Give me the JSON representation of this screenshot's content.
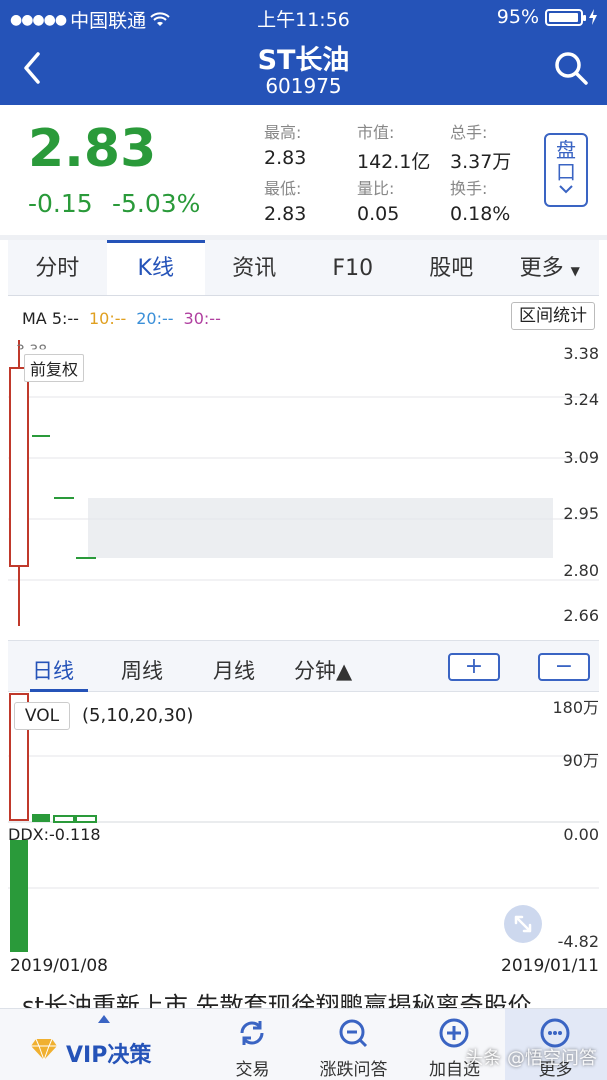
{
  "status_bar": {
    "carrier": "中国联通",
    "time": "上午11:56",
    "battery": "95%"
  },
  "header": {
    "title": "ST长油",
    "code": "601975"
  },
  "quote": {
    "price": "2.83",
    "change": "-0.15",
    "change_pct": "-5.03%",
    "stats": [
      {
        "label": "最高:",
        "value": "2.83"
      },
      {
        "label": "市值:",
        "value": "142.1亿"
      },
      {
        "label": "总手:",
        "value": "3.37万"
      },
      {
        "label": "最低:",
        "value": "2.83"
      },
      {
        "label": "量比:",
        "value": "0.05"
      },
      {
        "label": "换手:",
        "value": "0.18%"
      }
    ],
    "pan_button": "盘口"
  },
  "tabs": [
    "分时",
    "K线",
    "资讯",
    "F10",
    "股吧",
    "更多"
  ],
  "active_tab": "K线",
  "chart": {
    "ma": {
      "ma5": "MA 5:--",
      "ma10": "10:--",
      "ma20": "20:--",
      "ma30": "30:--"
    },
    "ma_colors": {
      "ma5": "#222222",
      "ma10": "#e0a020",
      "ma20": "#3a8fd8",
      "ma30": "#b040a0"
    },
    "range_button": "区间统计",
    "adjust_label": "前复权",
    "top_price_label": "3.38",
    "y_ticks": [
      "3.38",
      "3.24",
      "3.09",
      "2.95",
      "2.80",
      "2.66"
    ],
    "up_color": "#c0392b",
    "down_color": "#2a9a3a"
  },
  "periods": {
    "day": "日线",
    "week": "周线",
    "month": "月线",
    "minute": "分钟▲",
    "zoom_in": "+",
    "zoom_out": "−"
  },
  "volume": {
    "tag": "VOL",
    "params": "(5,10,20,30)",
    "y_ticks": [
      "180万",
      "90万"
    ],
    "ddx_label": "DDX:-0.118",
    "ddx_ticks": [
      "0.00",
      "-4.82"
    ],
    "date_start": "2019/01/08",
    "date_end": "2019/01/11"
  },
  "news_headline": "st长油重新上市 先散套现徐翔鹏赢揭秘离奇股价",
  "bottom_bar": {
    "vip": "VIP决策",
    "items": [
      "交易",
      "涨跌问答",
      "加自选",
      "更多"
    ]
  },
  "watermark": "头条 @悟空问答"
}
